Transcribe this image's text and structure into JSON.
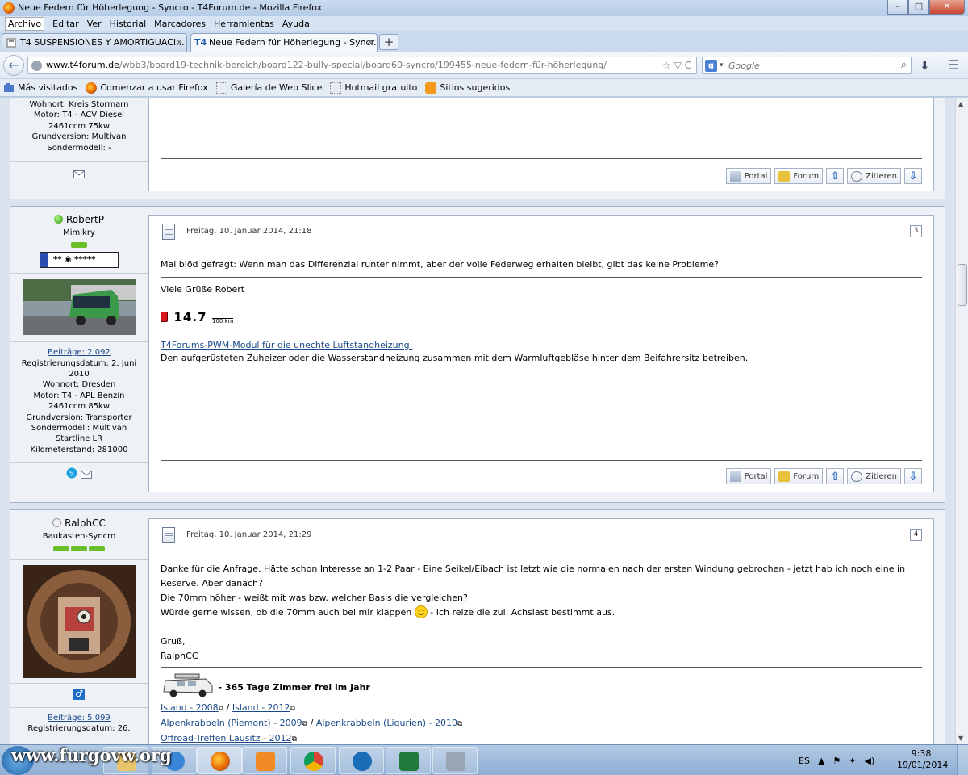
{
  "window": {
    "title": "Neue Federn für Höherlegung - Syncro - T4Forum.de - Mozilla Firefox",
    "min": "–",
    "max": "□",
    "close": "✕"
  },
  "menu": [
    "Archivo",
    "Editar",
    "Ver",
    "Historial",
    "Marcadores",
    "Herramientas",
    "Ayuda"
  ],
  "tabs": [
    {
      "label": "T4 SUSPENSIONES Y AMORTIGUACI...",
      "close": "✕"
    },
    {
      "label": "Neue Federn für Höherlegung - Syncr...",
      "close": "✕",
      "prefix": "T4"
    }
  ],
  "newtab": "+",
  "nav": {
    "back": "←",
    "url_host": "www.t4forum.de",
    "url_path": "/wbb3/board19-technik-bereich/board122-bully-special/board60-syncro/199455-neue-federn-für-höherlegung/",
    "url_icons": "☆ ▽ C",
    "search_placeholder": "Google",
    "search_arrow": "▾",
    "search_engine": "g",
    "search_btn": "⌕",
    "download": "⬇",
    "menu": "☰"
  },
  "bookmarks": [
    "Más visitados",
    "Comenzar a usar Firefox",
    "Galería de Web Slice",
    "Hotmail gratuito",
    "Sitios sugeridos"
  ],
  "post1": {
    "sidebar_lines": [
      "Wohnort: Kreis Stormarn",
      "Motor: T4 - ACV Diesel",
      "2461ccm 75kw",
      "Grundversion: Multivan",
      "Sondermodell: -"
    ],
    "buttons": {
      "portal": "Portal",
      "forum": "Forum",
      "zitieren": "Zitieren",
      "up": "⇧",
      "down": "⇩"
    }
  },
  "post2": {
    "username": "RobertP",
    "rank": "Mimikry",
    "plate": "** ◉ *****",
    "sidebar_beitrage": "Beiträge: 2 092",
    "sidebar_lines": [
      "Registrierungsdatum: 2. Juni",
      "2010",
      "Wohnort: Dresden",
      "Motor: T4 - APL Benzin",
      "2461ccm 85kw",
      "Grundversion: Transporter",
      "Sondermodell: Multivan",
      "Startline LR",
      "Kilometerstand: 281000"
    ],
    "date": "Freitag, 10. Januar 2014, 21:18",
    "num": "3",
    "text": "Mal blöd gefragt: Wenn man das Differenzial runter nimmt, aber der volle Federweg erhalten bleibt, gibt das keine Probleme?",
    "greeting": "Viele Grüße Robert",
    "fuel_value": "14.7",
    "fuel_unit_top": "l",
    "fuel_unit_bottom": "100 km",
    "sig_link": "T4Forums-PWM-Modul für die unechte Luftstandheizung:",
    "sig_text": "Den aufgerüsteten Zuheizer oder die Wasserstandheizung zusammen mit dem Warmluftgebläse hinter dem Beifahrersitz betreiben.",
    "buttons": {
      "portal": "Portal",
      "forum": "Forum",
      "zitieren": "Zitieren",
      "up": "⇧",
      "down": "⇩"
    }
  },
  "post3": {
    "username": "RalphCC",
    "rank": "Baukasten-Syncro",
    "gender": "♂",
    "sidebar_beitrage": "Beiträge: 5 099",
    "sidebar_reg": "Registrierungsdatum: 26.",
    "date": "Freitag, 10. Januar 2014, 21:29",
    "num": "4",
    "lines": [
      "Danke für die Anfrage. Hätte schon Interesse an 1-2 Paar - Eine Seikel/Eibach ist letzt wie die normalen nach der ersten Windung gebrochen - jetzt hab ich noch eine in",
      "Reserve. Aber danach?",
      "Die 70mm höher - weißt mit was bzw. welcher Basis die vergleichen?"
    ],
    "line4_before": "Würde gerne wissen, ob die 70mm auch bei mir klappen",
    "line4_after": "- Ich reize die zul. Achslast bestimmt aus.",
    "gruss": "Gruß,",
    "name": "RalphCC",
    "sig_title": "- 365 Tage Zimmer frei im Jahr",
    "sig_links": [
      [
        "Island - 2008",
        "Island - 2012"
      ],
      [
        "Alpenkrabbeln (Piemont) - 2009",
        "Alpenkrabbeln (Ligurien) - 2010"
      ],
      [
        "Offroad-Treffen Lausitz - 2012"
      ]
    ],
    "sig_sep": "/"
  },
  "taskbar": {
    "watermark": "www.furgovw.org",
    "lang": "ES",
    "time": "9:38",
    "date": "19/01/2014"
  }
}
